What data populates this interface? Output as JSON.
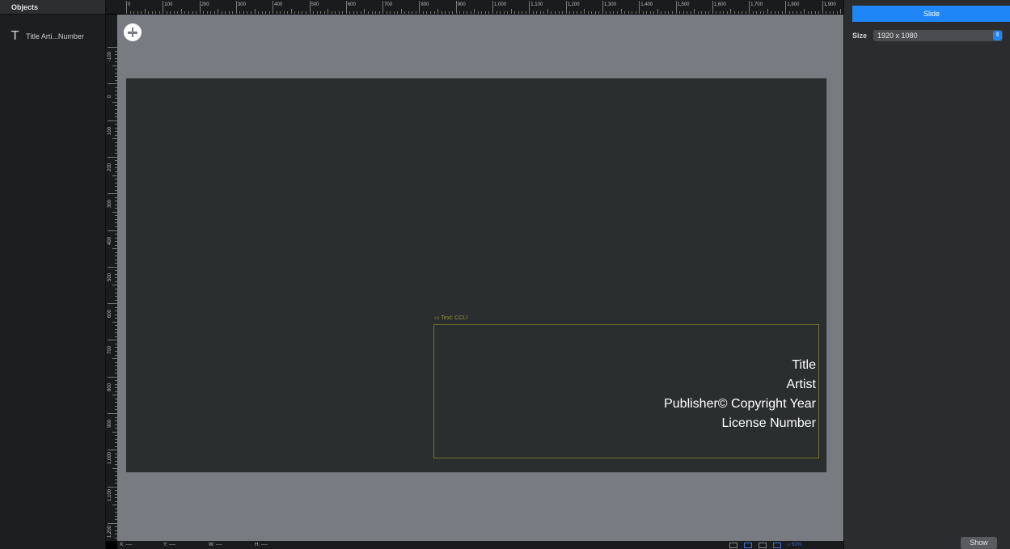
{
  "objects_panel": {
    "header": "Objects",
    "items": [
      {
        "icon": "text-icon",
        "glyph": "T",
        "label": "Title Arti...Number"
      }
    ]
  },
  "ruler": {
    "top_labels": [
      "0",
      "100",
      "200",
      "300",
      "400",
      "500",
      "600",
      "700",
      "800",
      "900",
      "1,000",
      "1,100",
      "1,200",
      "1,300",
      "1,400",
      "1,500",
      "1,600",
      "1,700",
      "1,800",
      "1,900"
    ],
    "left_labels": [
      "-100",
      "0",
      "100",
      "200",
      "300",
      "400",
      "500",
      "600",
      "700",
      "800",
      "900",
      "1,000",
      "1,100",
      "1,200"
    ]
  },
  "canvas": {
    "add_icon": "plus-circle-icon",
    "text_box_label": "▭ Text: CCLI",
    "slide_text": [
      "Title",
      "Artist",
      "Publisher© Copyright Year",
      "License Number"
    ]
  },
  "status_bar": {
    "x": "X: ----",
    "y": "Y: ----",
    "w": "W: ----",
    "h": "H: ----",
    "zoom": "⌕ 50%"
  },
  "inspector": {
    "tab": "Slide",
    "size_label": "Size",
    "size_value": "1920 x 1080",
    "show_button": "Show"
  },
  "colors": {
    "accent": "#1f86f7",
    "canvas_bg": "#787b82",
    "slide_bg": "#2b2e2f",
    "text_box_border": "#7a6c2a"
  }
}
